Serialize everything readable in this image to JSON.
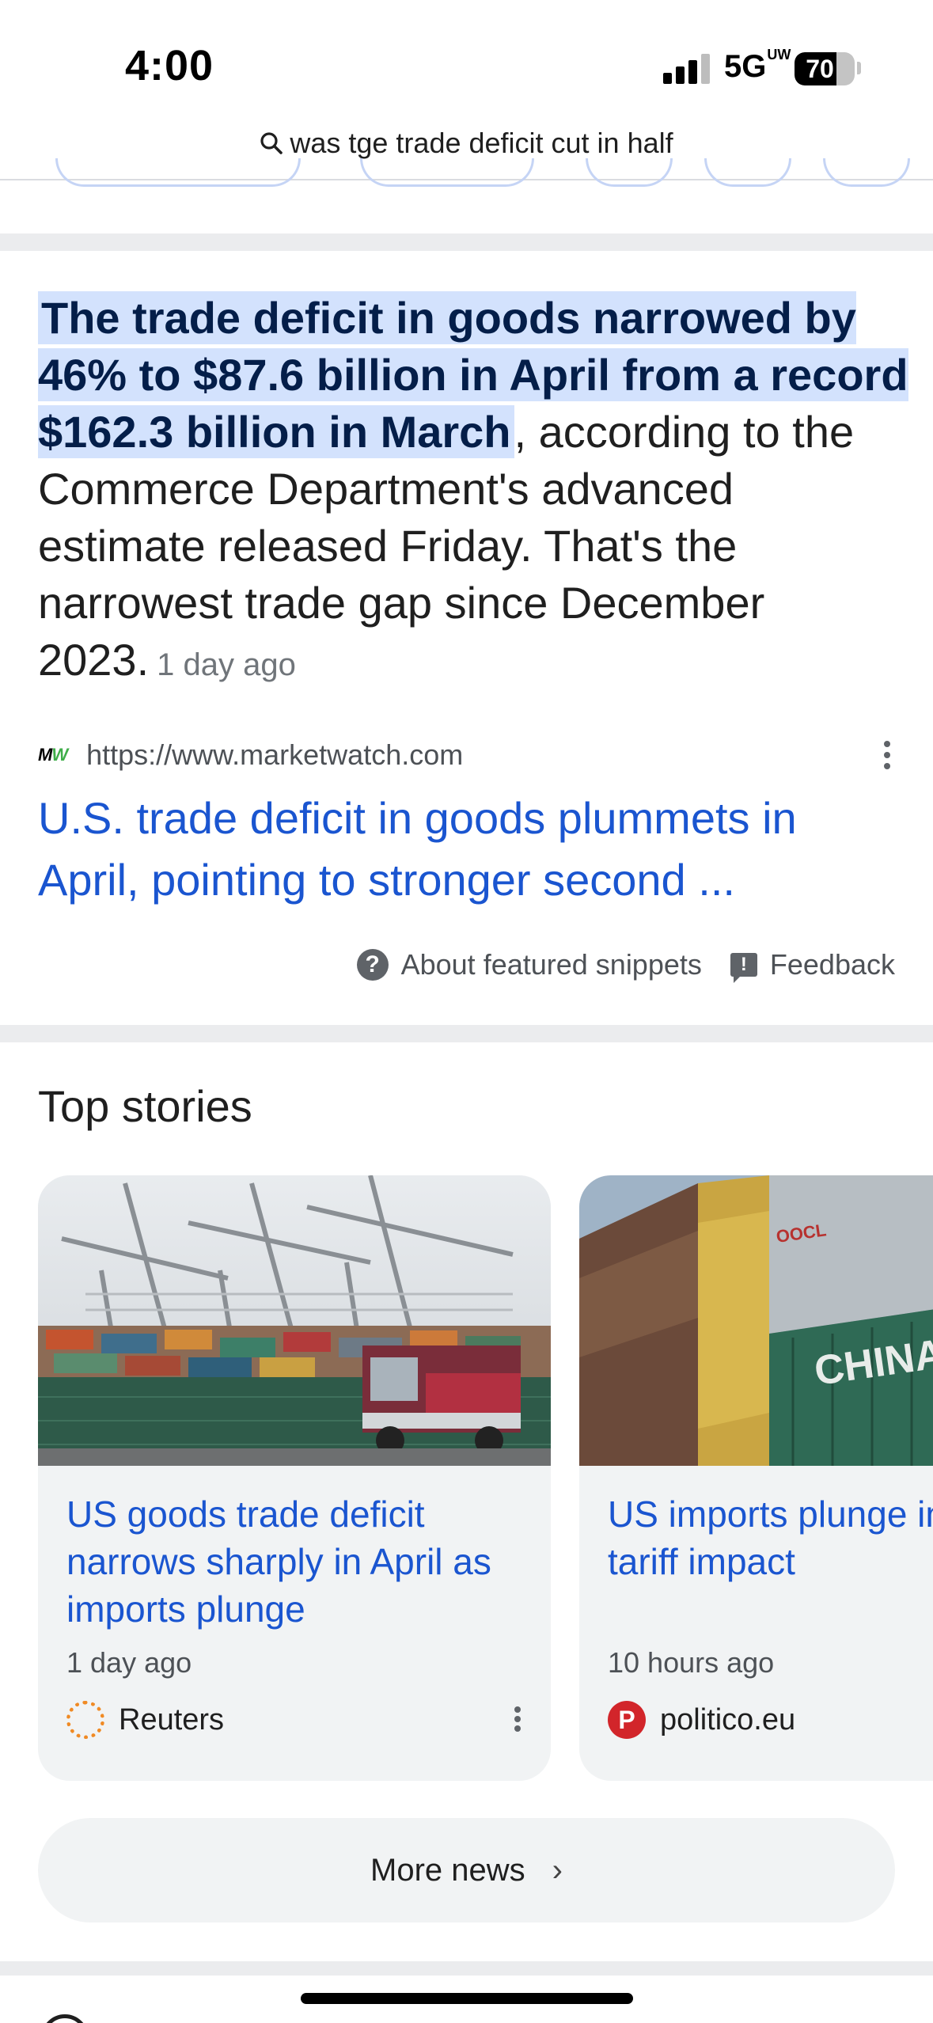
{
  "status_bar": {
    "time": "4:00",
    "network": "5G",
    "network_sup": "UW",
    "battery": "70"
  },
  "search": {
    "query": "was tge trade deficit cut in half"
  },
  "snippet": {
    "highlight": "The trade deficit in goods narrowed by 46% to $87.6 billion in April from a record $162.3 billion in March",
    "rest": ", according to the Commerce Department's advanced estimate released Friday. That's the narrowest trade gap since December 2023.",
    "age": "1 day ago",
    "source_url": "https://www.marketwatch.com",
    "source_logo": "MW",
    "title": "U.S. trade deficit in goods plummets in April, pointing to stronger second ...",
    "about_label": "About featured snippets",
    "feedback_label": "Feedback"
  },
  "top_stories": {
    "title": "Top stories",
    "cards": [
      {
        "headline": "US goods trade deficit narrows sharply in April as imports plunge",
        "time": "1 day ago",
        "publisher": "Reuters"
      },
      {
        "headline": "US imports plunge in early sign of Trump tariff impact",
        "time": "10 hours ago",
        "publisher": "politico.eu",
        "publisher_logo": "P",
        "image_text_1": "CHINA SH",
        "image_text_2": "OOCL"
      }
    ],
    "more_news_label": "More news"
  },
  "colors": {
    "link_blue": "#1a55d0",
    "highlight_bg": "#d3e2fd",
    "card_bg": "#f1f3f4"
  }
}
